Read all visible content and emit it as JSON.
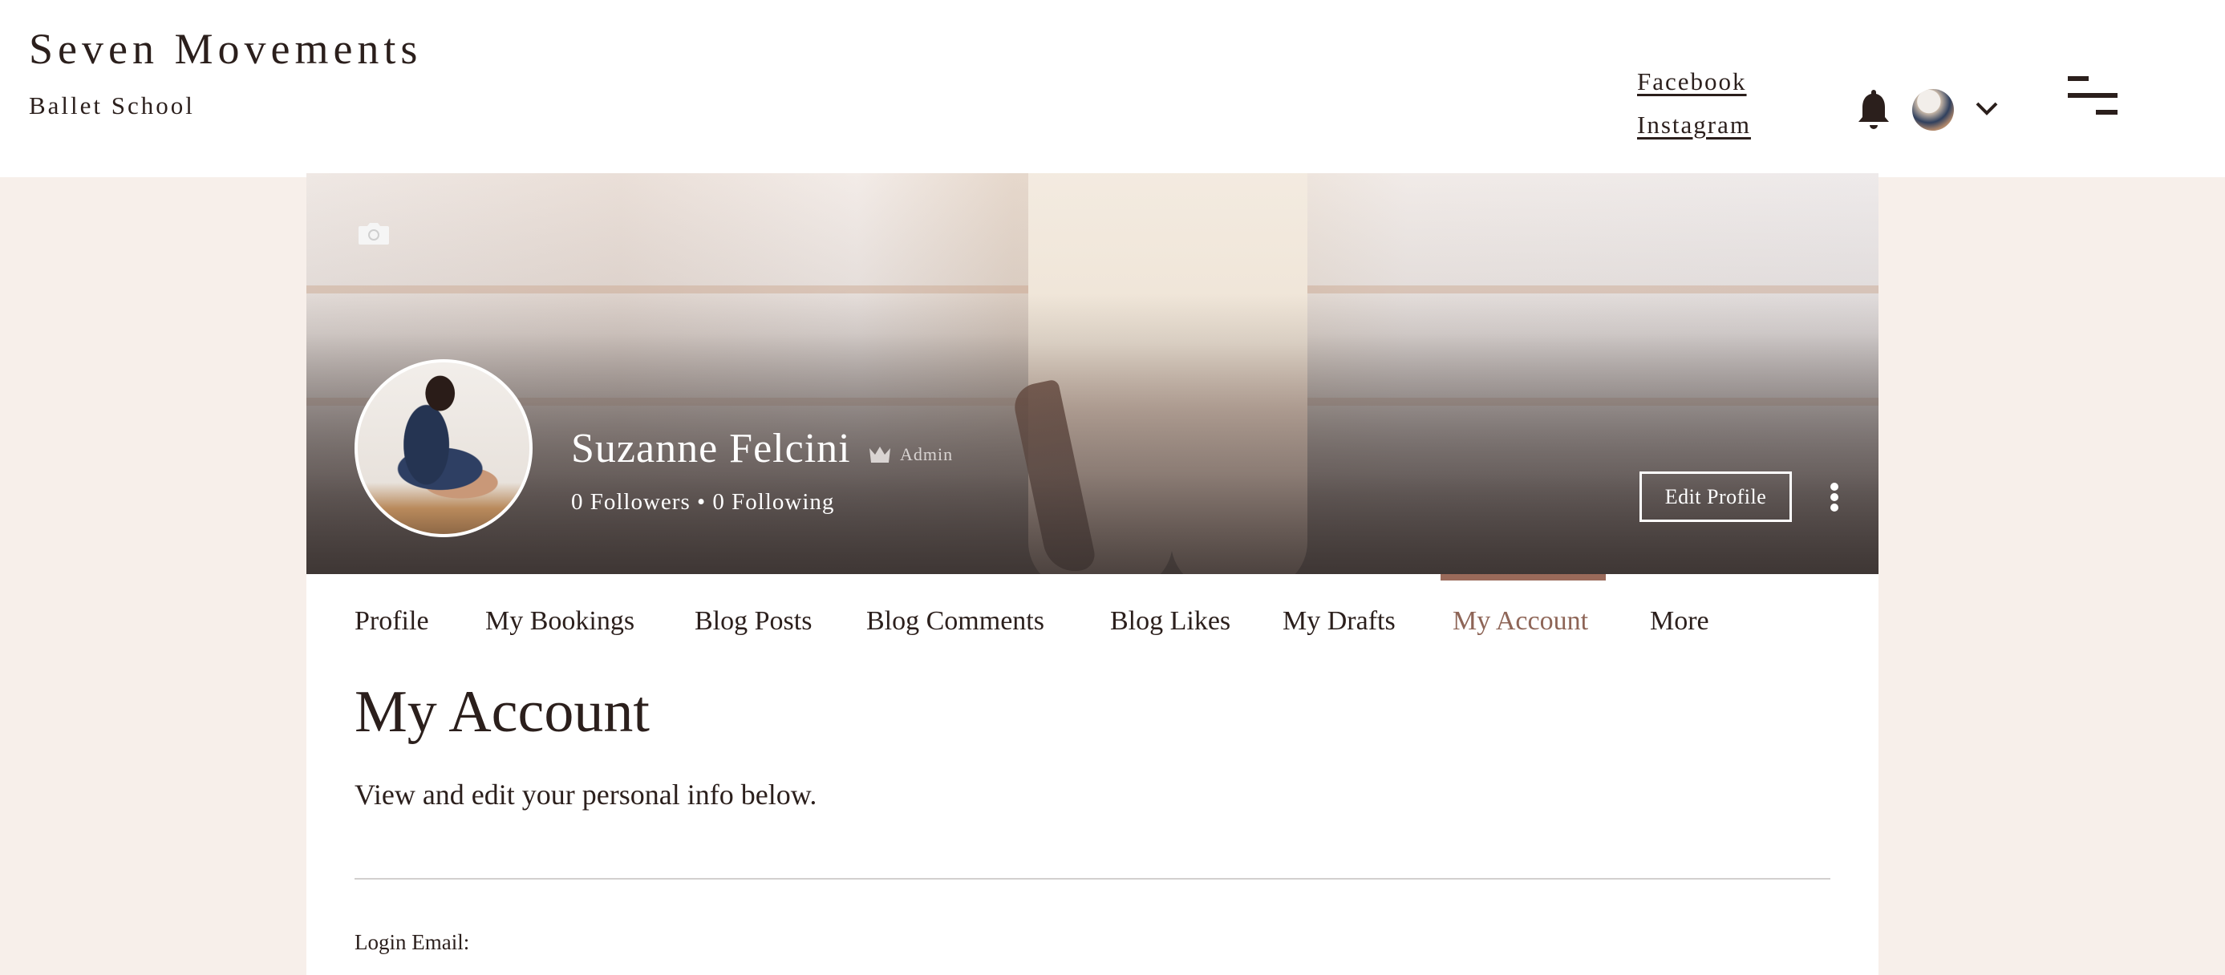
{
  "header": {
    "brand_title": "Seven Movements",
    "brand_subtitle": "Ballet School",
    "social_links": [
      "Facebook",
      "Instagram"
    ],
    "icons": {
      "notifications": "bell-icon",
      "user_avatar": "avatar",
      "account_menu": "chevron-down-icon",
      "site_menu": "menu-icon"
    }
  },
  "profile": {
    "cover_icon": "camera-icon",
    "name": "Suzanne Felcini",
    "role_badge": "Admin",
    "role_icon": "crown-icon",
    "followers_count": "0",
    "followers_label": "Followers",
    "following_count": "0",
    "following_label": "Following",
    "stats_text": "0 Followers • 0 Following",
    "edit_button": "Edit Profile",
    "more_icon": "more-vertical-icon"
  },
  "tabs": {
    "items": [
      {
        "label": "Profile",
        "active": false
      },
      {
        "label": "My Bookings",
        "active": false
      },
      {
        "label": "Blog Posts",
        "active": false
      },
      {
        "label": "Blog Comments",
        "active": false
      },
      {
        "label": "Blog Likes",
        "active": false
      },
      {
        "label": "My Drafts",
        "active": false
      },
      {
        "label": "My Account",
        "active": true
      },
      {
        "label": "More",
        "active": false
      }
    ]
  },
  "account": {
    "title": "My Account",
    "subtitle": "View and edit your personal info below.",
    "login_email_label": "Login Email:"
  },
  "colors": {
    "accent": "#9a6a5a",
    "active_tab_text": "#8e6557",
    "page_background": "#f7efea",
    "text": "#2b1f1c"
  }
}
